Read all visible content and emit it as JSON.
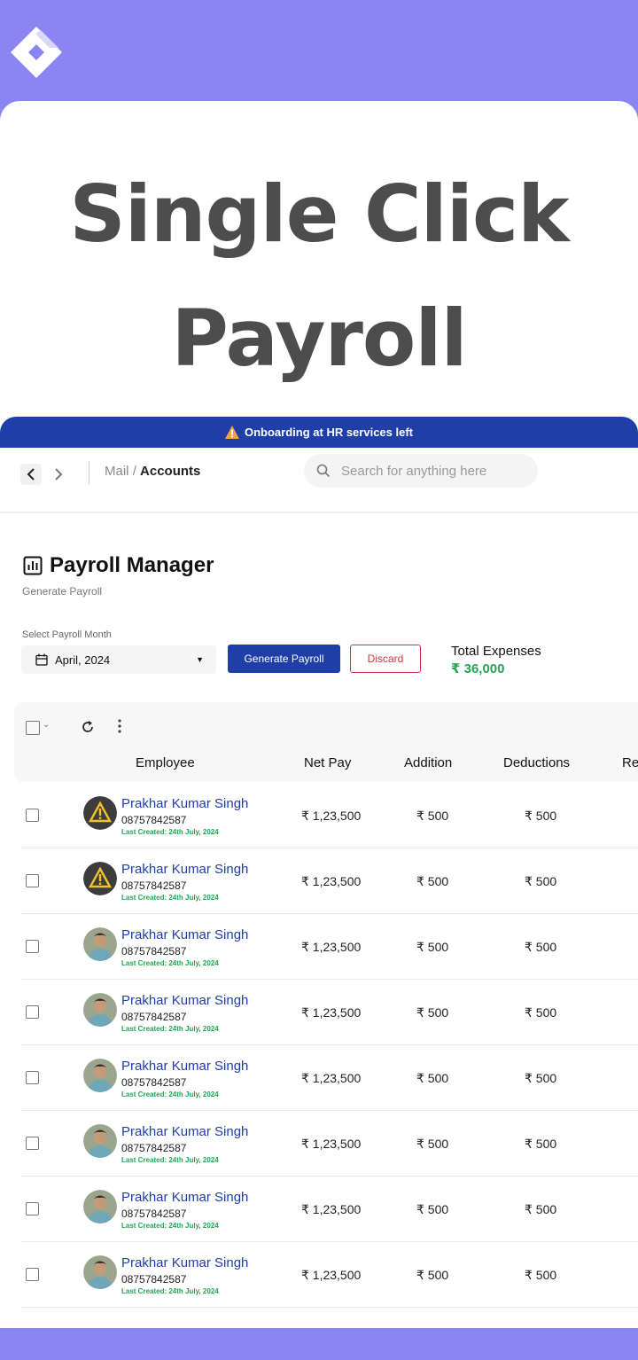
{
  "headline": {
    "line1": "Single Click",
    "line2": "Payroll"
  },
  "banner": {
    "icon": "warning-icon",
    "text": "Onboarding at HR services left"
  },
  "topbar": {
    "breadcrumb_parent": "Mail",
    "breadcrumb_sep": "/",
    "breadcrumb_current": "Accounts",
    "search_placeholder": "Search for anything here"
  },
  "page": {
    "title": "Payroll Manager",
    "subtitle": "Generate Payroll",
    "month_label": "Select Payroll Month",
    "month_value": "April, 2024",
    "generate_label": "Generate Payroll",
    "discard_label": "Discard",
    "total_label": "Total Expenses",
    "total_value": "₹ 36,000"
  },
  "table": {
    "columns": [
      "Employee",
      "Net Pay",
      "Addition",
      "Deductions",
      "Re"
    ],
    "rows": [
      {
        "name": "Prakhar Kumar Singh",
        "phone": "08757842587",
        "created": "Last Created: 24th July, 2024",
        "net_pay": "₹ 1,23,500",
        "addition": "₹ 500",
        "deductions": "₹ 500",
        "avatar": "warning"
      },
      {
        "name": "Prakhar Kumar Singh",
        "phone": "08757842587",
        "created": "Last Created: 24th July, 2024",
        "net_pay": "₹ 1,23,500",
        "addition": "₹ 500",
        "deductions": "₹ 500",
        "avatar": "warning"
      },
      {
        "name": "Prakhar Kumar Singh",
        "phone": "08757842587",
        "created": "Last Created: 24th July, 2024",
        "net_pay": "₹ 1,23,500",
        "addition": "₹ 500",
        "deductions": "₹ 500",
        "avatar": "photo"
      },
      {
        "name": "Prakhar Kumar Singh",
        "phone": "08757842587",
        "created": "Last Created: 24th July, 2024",
        "net_pay": "₹ 1,23,500",
        "addition": "₹ 500",
        "deductions": "₹ 500",
        "avatar": "photo"
      },
      {
        "name": "Prakhar Kumar Singh",
        "phone": "08757842587",
        "created": "Last Created: 24th July, 2024",
        "net_pay": "₹ 1,23,500",
        "addition": "₹ 500",
        "deductions": "₹ 500",
        "avatar": "photo"
      },
      {
        "name": "Prakhar Kumar Singh",
        "phone": "08757842587",
        "created": "Last Created: 24th July, 2024",
        "net_pay": "₹ 1,23,500",
        "addition": "₹ 500",
        "deductions": "₹ 500",
        "avatar": "photo"
      },
      {
        "name": "Prakhar Kumar Singh",
        "phone": "08757842587",
        "created": "Last Created: 24th July, 2024",
        "net_pay": "₹ 1,23,500",
        "addition": "₹ 500",
        "deductions": "₹ 500",
        "avatar": "photo"
      },
      {
        "name": "Prakhar Kumar Singh",
        "phone": "08757842587",
        "created": "Last Created: 24th July, 2024",
        "net_pay": "₹ 1,23,500",
        "addition": "₹ 500",
        "deductions": "₹ 500",
        "avatar": "photo"
      }
    ]
  },
  "colors": {
    "background": "#8a85f2",
    "brand": "#1f3ea8",
    "success": "#22a652",
    "danger": "#d6333f"
  }
}
